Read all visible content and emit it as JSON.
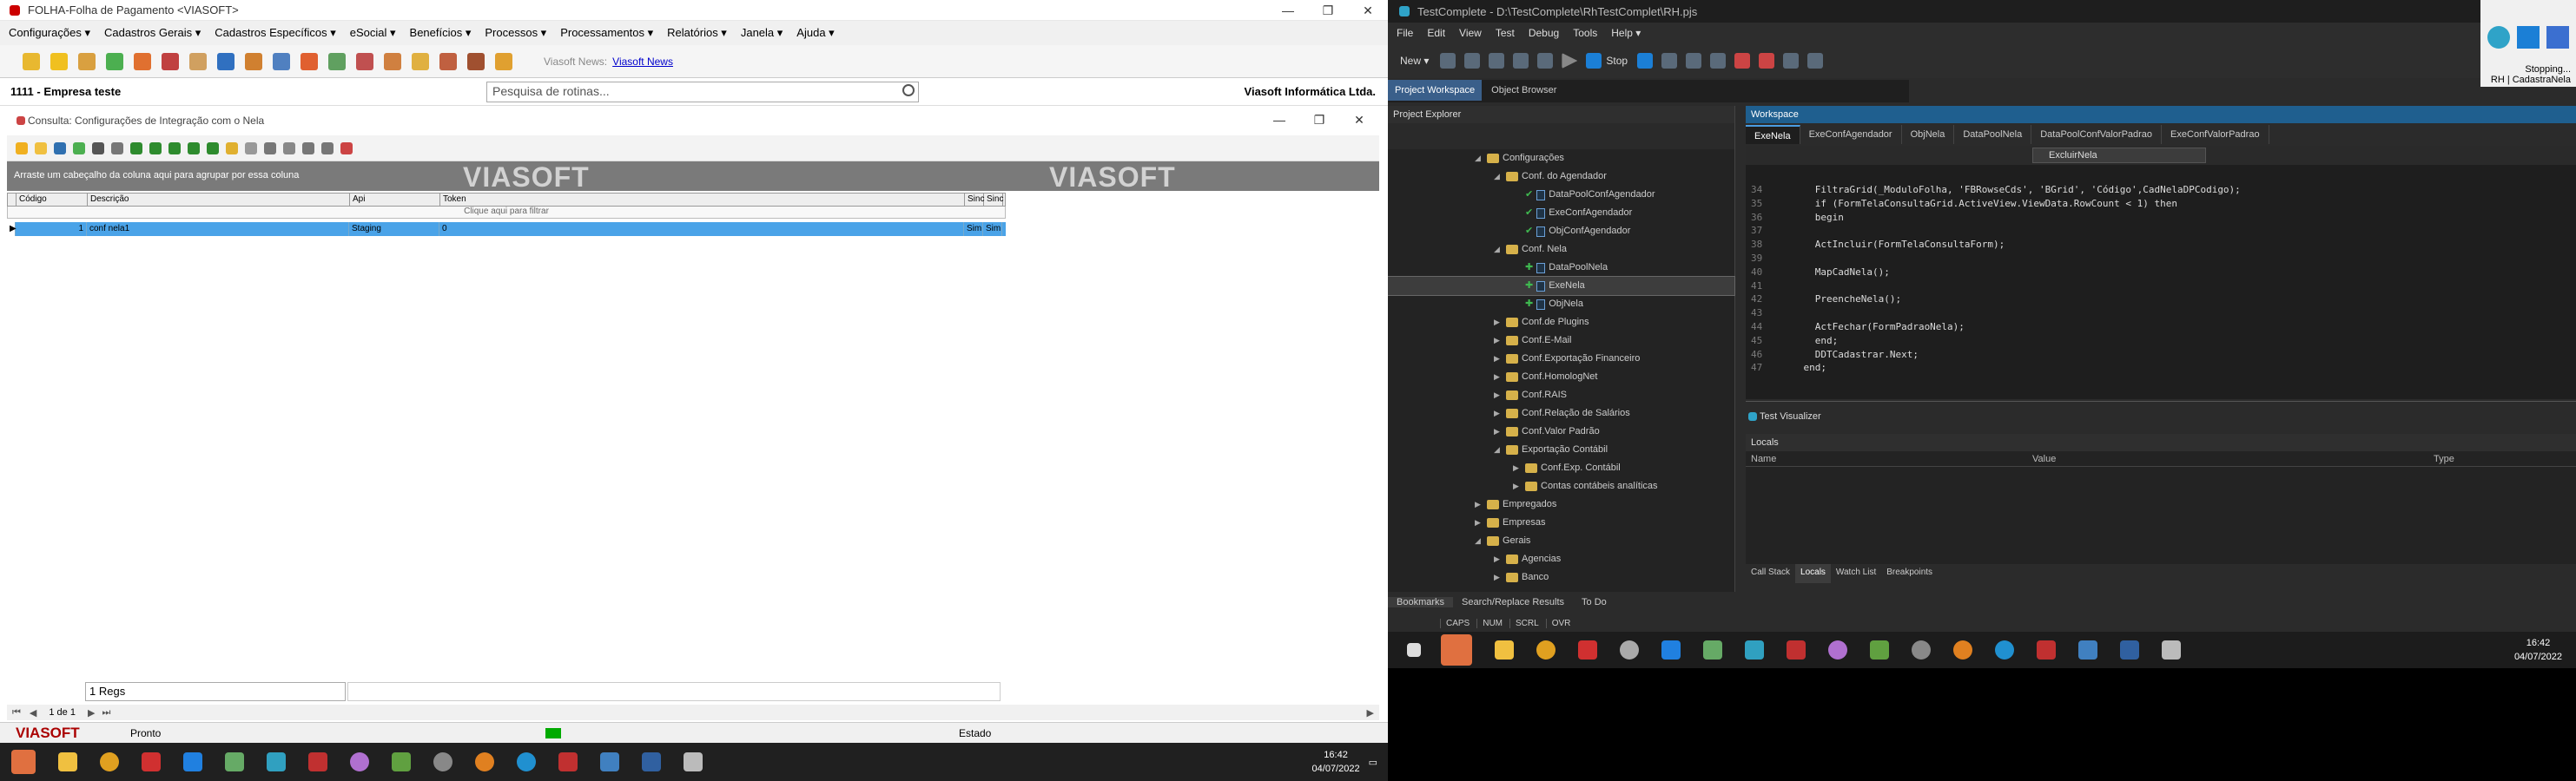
{
  "left": {
    "title": "FOLHA-Folha de Pagamento <VIASOFT>",
    "menu": [
      "Configurações ▾",
      "Cadastros Gerais ▾",
      "Cadastros Específicos ▾",
      "eSocial ▾",
      "Benefícios ▾",
      "Processos ▾",
      "Processamentos ▾",
      "Relatórios ▾",
      "Janela ▾",
      "Ajuda ▾"
    ],
    "news_label": "Viasoft News:",
    "news_link": "Viasoft News",
    "company": "1111 - Empresa teste",
    "vendor": "Viasoft Informática Ltda.",
    "search_placeholder": "Pesquisa de rotinas...",
    "child_title": "Consulta: Configurações de Integração com o Nela",
    "group_hint": "Arraste um cabeçalho da coluna aqui para agrupar por essa coluna",
    "logo": "VIASOFT",
    "grid": {
      "columns": [
        "Código",
        "Descrição",
        "Api",
        "Token",
        "Sinc",
        "Sinc"
      ],
      "filter_hint": "Clique aqui para filtrar",
      "rows": [
        [
          "1",
          "conf nela1",
          "Staging",
          "0",
          "Sim",
          "Sim"
        ]
      ]
    },
    "regs": "1 Regs",
    "nav_page": "1 de 1",
    "status_logo": "VIASOFT",
    "status_ready": "Pronto",
    "status_state": "Estado",
    "clock_time": "16:42",
    "clock_date": "04/07/2022"
  },
  "right": {
    "title": "TestComplete - D:\\TestComplete\\RhTestComplet\\RH.pjs",
    "menu": [
      "File",
      "Edit",
      "View",
      "Test",
      "Debug",
      "Tools",
      "Help ▾"
    ],
    "new_label": "New ▾",
    "stop_label": "Stop",
    "stopping": "Stopping...",
    "stopping_sub": "RH | CadastraNela",
    "left_tabs": [
      "Project Workspace",
      "Object Browser"
    ],
    "pe_title": "Project Explorer",
    "tree": [
      {
        "label": "Configurações",
        "indent": 1,
        "type": "folder",
        "exp": "◢"
      },
      {
        "label": "Conf. do Agendador",
        "indent": 2,
        "type": "folder",
        "exp": "◢"
      },
      {
        "label": "DataPoolConfAgendador",
        "indent": 3,
        "type": "doc",
        "check": "✔"
      },
      {
        "label": "ExeConfAgendador",
        "indent": 3,
        "type": "doc",
        "check": "✔"
      },
      {
        "label": "ObjConfAgendador",
        "indent": 3,
        "type": "doc",
        "check": "✔"
      },
      {
        "label": "Conf. Nela",
        "indent": 2,
        "type": "folder",
        "exp": "◢"
      },
      {
        "label": "DataPoolNela",
        "indent": 3,
        "type": "doc",
        "check": "✚"
      },
      {
        "label": "ExeNela",
        "indent": 3,
        "type": "doc",
        "check": "✚",
        "sel": true
      },
      {
        "label": "ObjNela",
        "indent": 3,
        "type": "doc",
        "check": "✚"
      },
      {
        "label": "Conf.de Plugins",
        "indent": 2,
        "type": "folder",
        "exp": "▶"
      },
      {
        "label": "Conf.E-Mail",
        "indent": 2,
        "type": "folder",
        "exp": "▶"
      },
      {
        "label": "Conf.Exportação Financeiro",
        "indent": 2,
        "type": "folder",
        "exp": "▶"
      },
      {
        "label": "Conf.HomologNet",
        "indent": 2,
        "type": "folder",
        "exp": "▶"
      },
      {
        "label": "Conf.RAIS",
        "indent": 2,
        "type": "folder",
        "exp": "▶"
      },
      {
        "label": "Conf.Relação de Salários",
        "indent": 2,
        "type": "folder",
        "exp": "▶"
      },
      {
        "label": "Conf.Valor Padrão",
        "indent": 2,
        "type": "folder",
        "exp": "▶"
      },
      {
        "label": "Exportação Contábil",
        "indent": 2,
        "type": "folder",
        "exp": "◢"
      },
      {
        "label": "Conf.Exp. Contábil",
        "indent": 3,
        "type": "folder",
        "exp": "▶"
      },
      {
        "label": "Contas contábeis analíticas",
        "indent": 3,
        "type": "folder",
        "exp": "▶"
      },
      {
        "label": "Empregados",
        "indent": 1,
        "type": "folder",
        "exp": "▶"
      },
      {
        "label": "Empresas",
        "indent": 1,
        "type": "folder",
        "exp": "▶"
      },
      {
        "label": "Gerais",
        "indent": 1,
        "type": "folder",
        "exp": "◢"
      },
      {
        "label": "Agencias",
        "indent": 2,
        "type": "folder",
        "exp": "▶"
      },
      {
        "label": "Banco",
        "indent": 2,
        "type": "folder",
        "exp": "▶"
      }
    ],
    "ws_title": "Workspace",
    "ws_tabs": [
      "ExeNela",
      "ExeConfAgendador",
      "ObjNela",
      "DataPoolNela",
      "DataPoolConfValorPadrao",
      "ExeConfValorPadrao"
    ],
    "routine": "ExcluirNela",
    "code": [
      {
        "n": "34",
        "t": "      FiltraGrid(_ModuloFolha, 'FBRowseCds', 'BGrid', 'Código',CadNelaDPCodigo);"
      },
      {
        "n": "35",
        "t": "      if (FormTelaConsultaGrid.ActiveView.ViewData.RowCount < 1) then"
      },
      {
        "n": "36",
        "t": "      begin"
      },
      {
        "n": "37",
        "t": ""
      },
      {
        "n": "38",
        "t": "      ActIncluir(FormTelaConsultaForm);"
      },
      {
        "n": "39",
        "t": ""
      },
      {
        "n": "40",
        "t": "      MapCadNela();"
      },
      {
        "n": "41",
        "t": ""
      },
      {
        "n": "42",
        "t": "      PreencheNela();"
      },
      {
        "n": "43",
        "t": ""
      },
      {
        "n": "44",
        "t": "      ActFechar(FormPadraoNela);"
      },
      {
        "n": "45",
        "t": "      end;"
      },
      {
        "n": "46",
        "t": "      DDTCadastrar.Next;"
      },
      {
        "n": "47",
        "t": "    end;"
      }
    ],
    "tv_title": "Test Visualizer",
    "locals_title": "Locals",
    "locals_cols": [
      "Name",
      "Value",
      "Type"
    ],
    "locals_tabs": [
      "Call Stack",
      "Locals",
      "Watch List",
      "Breakpoints"
    ],
    "bm_tabs": [
      "Bookmarks",
      "Search/Replace Results",
      "To Do"
    ],
    "caps": [
      "CAPS",
      "NUM",
      "SCRL",
      "OVR"
    ],
    "clock_time": "16:42",
    "clock_date": "04/07/2022"
  }
}
